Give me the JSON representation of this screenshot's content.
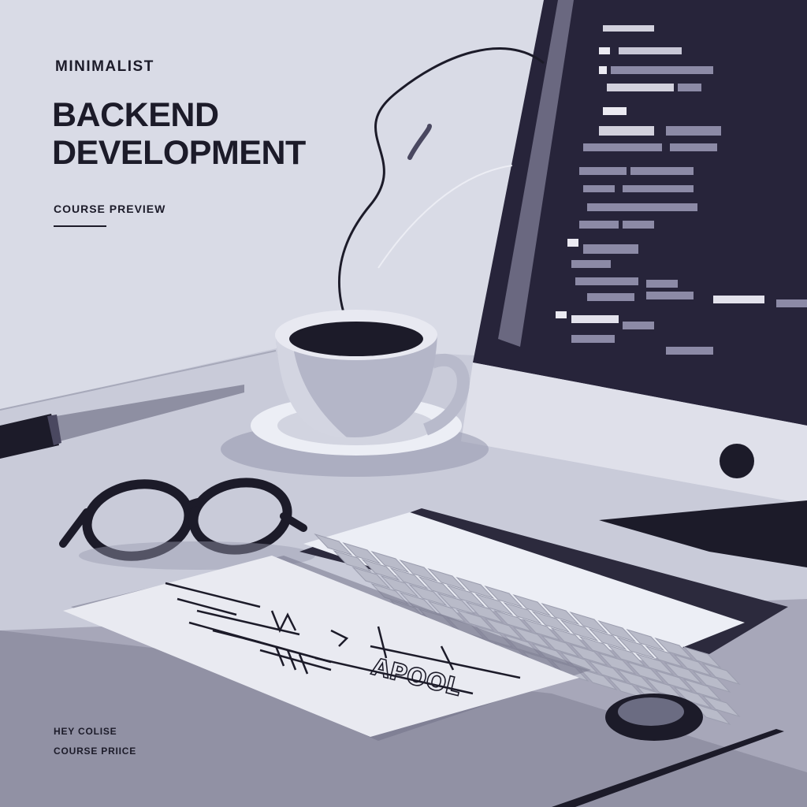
{
  "header": {
    "eyebrow": "MINIMALIST",
    "title_line1": "BACKEND",
    "title_line2": "DEVELOPMENT",
    "subtitle": "COURSE PREVIEW"
  },
  "footer": {
    "line1": "HEY COLISE",
    "line2": "COURSE PRIICE"
  },
  "notepad": {
    "scribble": "APOOL"
  },
  "colors": {
    "background": "#d9dbe6",
    "desk": "#c7c9d8",
    "ink": "#1c1b29",
    "screen": "#262338",
    "keys": "#b9bbc9"
  },
  "icons": [
    "coffee-cup-icon",
    "glasses-icon",
    "pen-icon",
    "keyboard-icon",
    "monitor-icon",
    "notepad-icon",
    "ring-icon"
  ]
}
